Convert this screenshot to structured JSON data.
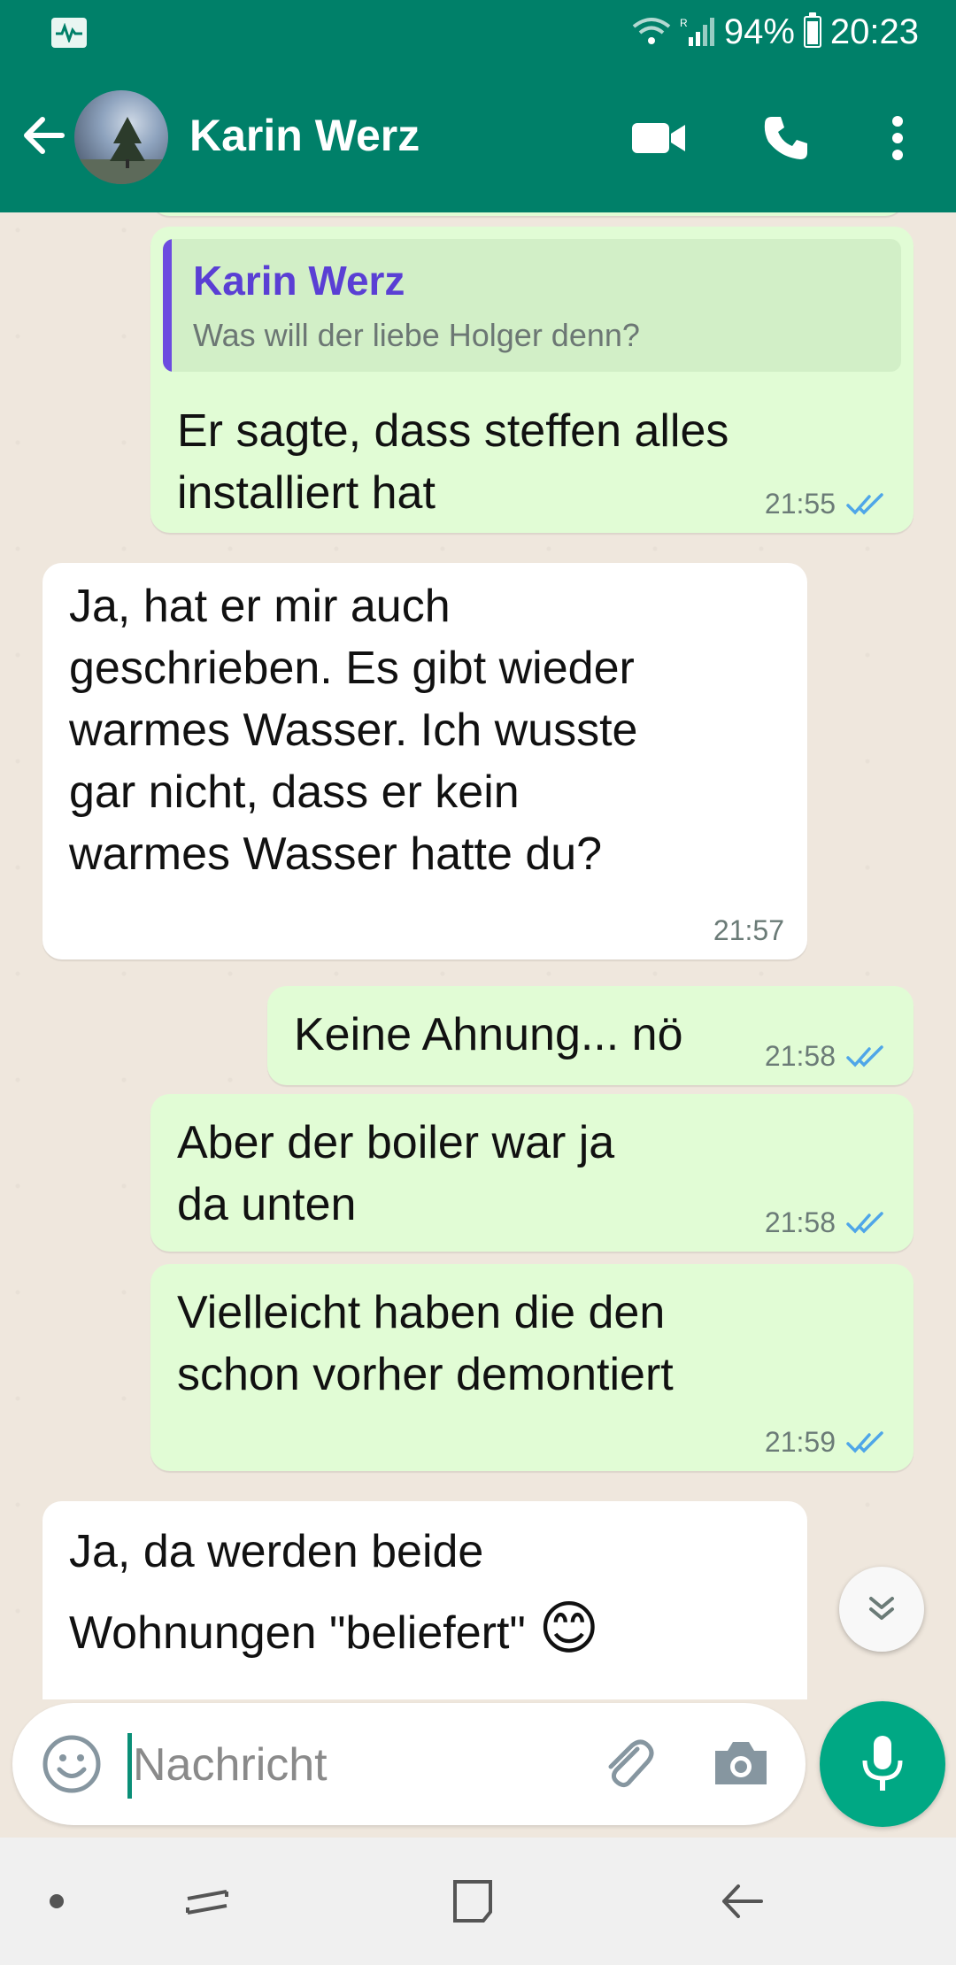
{
  "status_bar": {
    "battery": "94%",
    "time": "20:23"
  },
  "header": {
    "contact_name": "Karin Werz"
  },
  "messages": [
    {
      "reply_to": {
        "name": "Karin Werz",
        "text": "Was will der liebe Holger denn?"
      },
      "lines": [
        "Er sagte, dass steffen alles",
        "installiert hat"
      ],
      "time": "21:55"
    },
    {
      "lines": [
        "Ja, hat er mir auch",
        "geschrieben. Es gibt wieder",
        "warmes Wasser. Ich wusste",
        "gar nicht, dass er kein",
        "warmes Wasser hatte du?"
      ],
      "time": "21:57"
    },
    {
      "lines": [
        "Keine Ahnung... nö"
      ],
      "time": "21:58"
    },
    {
      "lines": [
        "Aber der boiler war ja",
        "da unten"
      ],
      "time": "21:58"
    },
    {
      "lines": [
        "Vielleicht haben die den",
        "schon vorher demontiert"
      ],
      "time": "21:59"
    },
    {
      "lines": [
        "Ja, da werden beide",
        "Wohnungen \"beliefert\""
      ],
      "emoji": "😊"
    }
  ],
  "composer": {
    "placeholder": "Nachricht"
  },
  "colors": {
    "header": "#008069",
    "outgoing_bubble": "#e1fcd5",
    "incoming_bubble": "#ffffff",
    "read_ticks": "#4fa6e8",
    "mic_button": "#00a884"
  }
}
